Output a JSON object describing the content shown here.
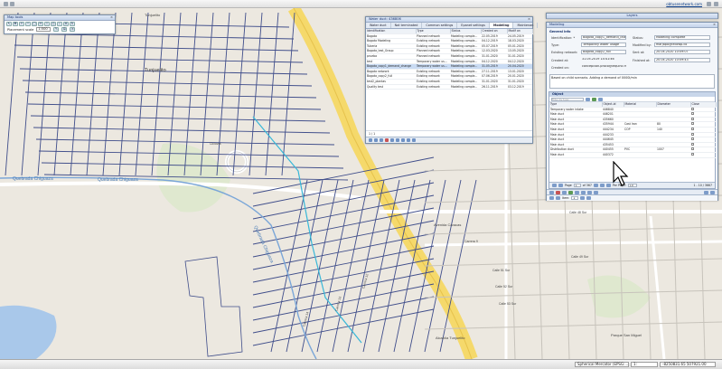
{
  "topbar": {
    "user": "obtusenetwork.com"
  },
  "map_labels": {
    "tunjuelito_top": "Tunjuelito",
    "tunjuelito_area": "Tunjuelito",
    "quebrada1": "Quebrada Chiguaza",
    "quebrada2": "Quebrada Chiguaza",
    "quebrada3": "Quebrada Chiguaza",
    "avenida": "Avenida Caracas",
    "alcaldia": "Alcaldía Tunjuelito",
    "parque": "Parque San Miguel",
    "ciclovia": "Ciclovía",
    "carrera9": "Carrera 9",
    "calle48": "Calle 48 Sur",
    "calle49": "Calle 49 Sur",
    "calle51": "Calle 51 Sur",
    "calle52": "Calle 52 Sur",
    "calle53": "Calle 53 Sur",
    "carrera12": "Carrera 12",
    "carrera13": "Carrera 13",
    "carrera14": "Carrera 14"
  },
  "map_tools": {
    "title": "Map tools",
    "placement_label": "Placement scale",
    "placement_value": "1:500"
  },
  "scenarios": {
    "title": "Water duct: 436806",
    "tabs": [
      "Water duct",
      "Not terminated",
      "Common settings",
      "Epanet settings",
      "Modeling",
      "Maintenan"
    ],
    "active_tab": 4,
    "columns": [
      "Identification",
      "Type",
      "Status",
      "Created on",
      "Modif on"
    ],
    "rows": [
      [
        "Bogota",
        "Planned network",
        "Modeling comple...",
        "22.05.2019",
        "24.05.2019"
      ],
      [
        "Bogota Modeling",
        "Existing network",
        "Modeling comple...",
        "04.12.2019",
        "18.03.2020"
      ],
      [
        "Tuberia",
        "Existing network",
        "Modeling comple...",
        "05.07.2019",
        "05.01.2020"
      ],
      [
        "Bogota_test_Group",
        "Planned network",
        "Modeling comple...",
        "12.03.2020",
        "13.05.2020"
      ],
      [
        "prueba",
        "Planned network",
        "Modeling comple...",
        "31.01.2020",
        "31.01.2020"
      ],
      [
        "test",
        "Temporary water us...",
        "Modeling comple...",
        "04.12.2020",
        "04.12.2020"
      ],
      [
        "Bogota_copy1_demand_change",
        "Temporary water us...",
        "Modeling comple...",
        "31.05.2019",
        "20.04.2020"
      ],
      [
        "Bogota network",
        "Existing network",
        "Modeling comple...",
        "27.11.2019",
        "13.01.2020"
      ],
      [
        "Bogota_copy2_full",
        "Existing network",
        "Modeling comple...",
        "07.06.2019",
        "20.01.2020"
      ],
      [
        "test2_plantas",
        "Existing network",
        "Modeling comple...",
        "31.01.2020",
        "31.01.2020"
      ],
      [
        "Quality test",
        "Existing network",
        "Modeling comple...",
        "26.11.2019",
        "03.12.2019"
      ]
    ],
    "selected_row": 6,
    "pager": "1 / 1"
  },
  "layers": {
    "title": "Layers"
  },
  "modeling": {
    "title": "Modeling",
    "general_info": "General info",
    "fields": {
      "identification_label": "Identification: *",
      "identification_value": "Bogota_copy1_demand_chan",
      "type_label": "Type:",
      "type_value": "Temporary water usage",
      "existing_label": "Existing network:",
      "existing_value": "Bogota_copy2_full",
      "created_at_label": "Created at:",
      "created_at_value": "31.05.2019 14:41:46",
      "created_on_label": "Created on:",
      "created_on_value": "concepcion.proco@iequinc.fr",
      "status_label": "Status:",
      "status_value": "Modeling complete",
      "modified_by_label": "Modified by:",
      "modified_by_value": "marjapo@iecowp.co",
      "sent_at_label": "Sent at:",
      "sent_at_value": "20.04.2020 10:09:07",
      "finished_label": "Finished at:",
      "finished_value": "20.04.2020 10:09:43"
    },
    "description": "Based on child scenario. Adding a demand of 0000l/min",
    "object_section": "Object",
    "filter_placeholder": "Filter by type",
    "obj_columns": [
      "Type",
      "Object-id",
      "Material",
      "Diameter",
      "Close"
    ],
    "obj_rows": [
      [
        "Temporary water intake",
        "446840",
        "",
        "",
        ""
      ],
      [
        "Main duct",
        "446201",
        "",
        "",
        ""
      ],
      [
        "Main duct",
        "435660",
        "",
        "",
        ""
      ],
      [
        "Main duct",
        "435944",
        "Cast Iron",
        "80",
        ""
      ],
      [
        "Main duct",
        "444234",
        "COP",
        "140",
        ""
      ],
      [
        "Main duct",
        "444233",
        "",
        "",
        ""
      ],
      [
        "Main duct",
        "444645",
        "",
        "",
        ""
      ],
      [
        "Main duct",
        "435453",
        "",
        "",
        ""
      ],
      [
        "Distribution duct",
        "440455",
        "PVC",
        "1007",
        ""
      ],
      [
        "Main duct",
        "440372",
        "",
        "",
        ""
      ]
    ],
    "obj_pager_page": "Page",
    "obj_pager_value": "1",
    "obj_pager_of": "of 367",
    "obj_per_page": "Per Page:",
    "obj_per_value": "10",
    "obj_range": "1 - 10 / 3667",
    "items_label": "Item:",
    "items_value": "1"
  },
  "statusbar": {
    "projection": "Spherical Mercator (EPSG:...",
    "scale": "1:",
    "coords": "-8250831.65 507921.00"
  }
}
